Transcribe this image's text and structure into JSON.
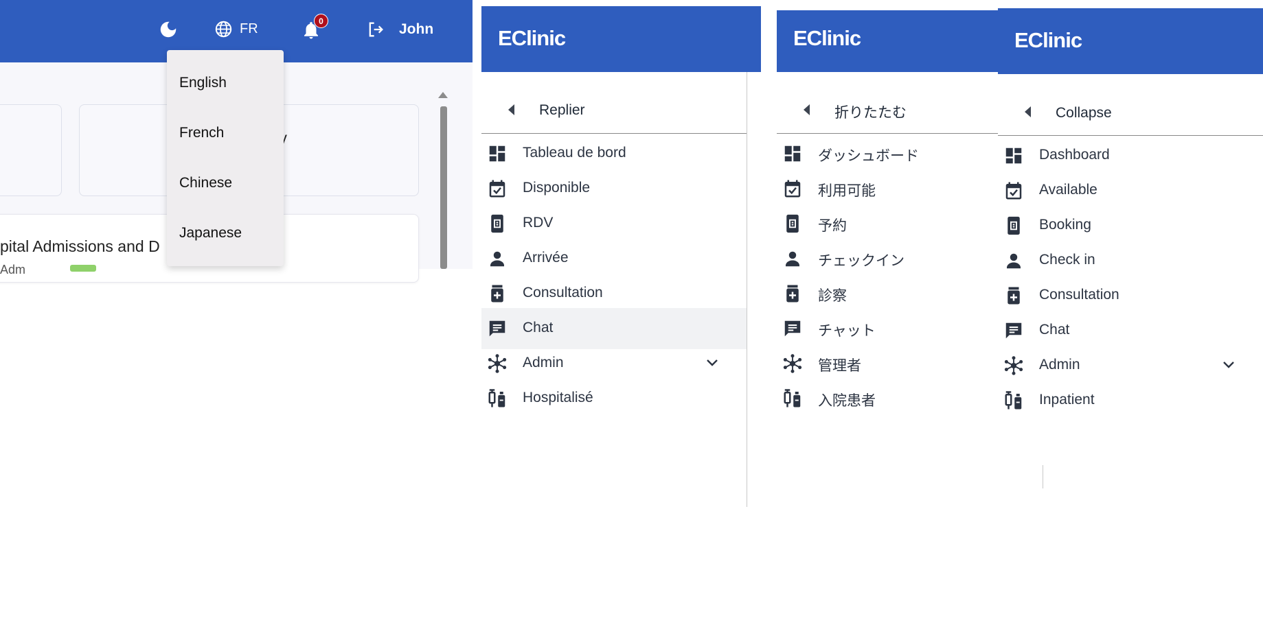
{
  "topbar": {
    "lang_code": "FR",
    "notification_count": "0",
    "user_name": "John"
  },
  "dashboard": {
    "card_partial_text": "ty",
    "chart_partial_title": "pital Admissions and D",
    "legend_partial": "Adm"
  },
  "language_dropdown": {
    "options": [
      "English",
      "French",
      "Chinese",
      "Japanese"
    ]
  },
  "sidebar_fr": {
    "brand": "EClinic",
    "collapse_label": "Replier",
    "items": [
      "Tableau de bord",
      "Disponible",
      "RDV",
      "Arrivée",
      "Consultation",
      "Chat",
      "Admin",
      "Hospitalisé"
    ]
  },
  "sidebar_ja": {
    "brand": "EClinic",
    "collapse_label": "折りたたむ",
    "items": [
      "ダッシュボード",
      "利用可能",
      "予約",
      "チェックイン",
      "診察",
      "チャット",
      "管理者",
      "入院患者"
    ]
  },
  "sidebar_en": {
    "brand": "EClinic",
    "collapse_label": "Collapse",
    "items": [
      "Dashboard",
      "Available",
      "Booking",
      "Check in",
      "Consultation",
      "Chat",
      "Admin",
      "Inpatient"
    ]
  },
  "colors": {
    "brand_blue": "#2f5dbe",
    "icon_dark": "#2c3442",
    "badge_red": "#b0101c"
  }
}
